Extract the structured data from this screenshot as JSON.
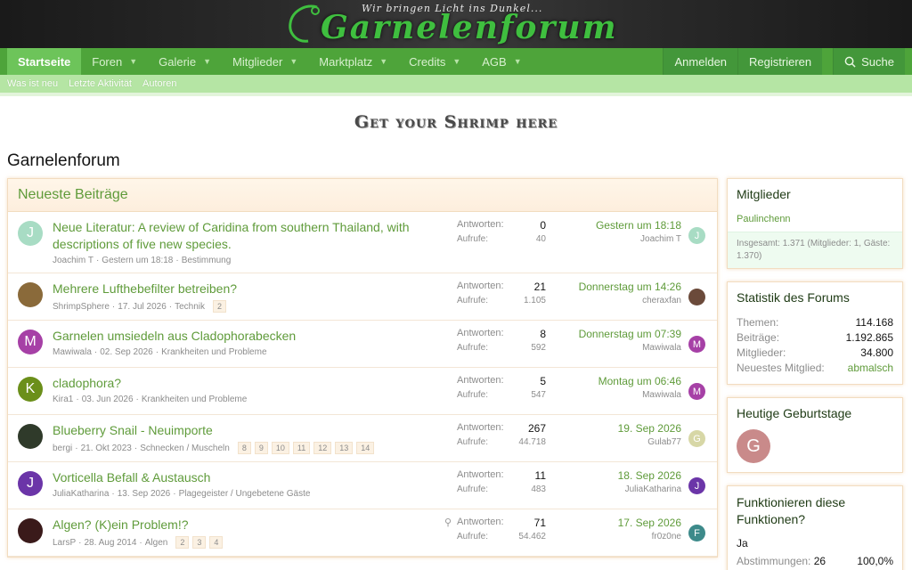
{
  "banner": {
    "tagline": "Wir bringen Licht ins Dunkel...",
    "brand": "Garnelenforum"
  },
  "nav": {
    "items": [
      {
        "label": "Startseite",
        "active": true,
        "caret": false
      },
      {
        "label": "Foren",
        "caret": true
      },
      {
        "label": "Galerie",
        "caret": true
      },
      {
        "label": "Mitglieder",
        "caret": true
      },
      {
        "label": "Marktplatz",
        "caret": true
      },
      {
        "label": "Credits",
        "caret": true
      },
      {
        "label": "AGB",
        "caret": true
      }
    ],
    "login": "Anmelden",
    "register": "Registrieren",
    "search": "Suche"
  },
  "subnav": [
    "Was ist neu",
    "Letzte Aktivität",
    "Autoren"
  ],
  "promo": "Get your Shrimp here",
  "page_title": "Garnelenforum",
  "latest": {
    "heading": "Neueste Beiträge",
    "answers_label": "Antworten:",
    "views_label": "Aufrufe:",
    "threads": [
      {
        "title": "Neue Literatur: A review of Caridina from southern Thailand, with descriptions of five new species.",
        "author": "Joachim T",
        "date": "Gestern um 18:18",
        "forum": "Bestimmung",
        "pages": [],
        "answers": "0",
        "views": "40",
        "last_date": "Gestern um 18:18",
        "last_user": "Joachim T",
        "avatar": "J",
        "avatar_color": "#a8dcc4",
        "last_avatar": "J",
        "last_avatar_color": "#a8dcc4",
        "pinned": false
      },
      {
        "title": "Mehrere Lufthebefilter betreiben?",
        "author": "ShrimpSphere",
        "date": "17. Jul 2026",
        "forum": "Technik",
        "pages": [
          "2"
        ],
        "answers": "21",
        "views": "1.105",
        "last_date": "Donnerstag um 14:26",
        "last_user": "cheraxfan",
        "avatar": "",
        "avatar_color": "#8a6a3a",
        "last_avatar": "",
        "last_avatar_color": "#6b4a3a",
        "pinned": false
      },
      {
        "title": "Garnelen umsiedeln aus Cladophorabecken",
        "author": "Mawiwala",
        "date": "02. Sep 2026",
        "forum": "Krankheiten und Probleme",
        "pages": [],
        "answers": "8",
        "views": "592",
        "last_date": "Donnerstag um 07:39",
        "last_user": "Mawiwala",
        "avatar": "M",
        "avatar_color": "#a640a6",
        "last_avatar": "M",
        "last_avatar_color": "#a640a6",
        "pinned": false
      },
      {
        "title": "cladophora?",
        "author": "Kira1",
        "date": "03. Jun 2026",
        "forum": "Krankheiten und Probleme",
        "pages": [],
        "answers": "5",
        "views": "547",
        "last_date": "Montag um 06:46",
        "last_user": "Mawiwala",
        "avatar": "K",
        "avatar_color": "#6b8f1a",
        "last_avatar": "M",
        "last_avatar_color": "#a640a6",
        "pinned": false
      },
      {
        "title": "Blueberry Snail - Neuimporte",
        "author": "bergi",
        "date": "21. Okt 2023",
        "forum": "Schnecken / Muscheln",
        "pages": [
          "8",
          "9",
          "10",
          "11",
          "12",
          "13",
          "14"
        ],
        "answers": "267",
        "views": "44.718",
        "last_date": "19. Sep 2026",
        "last_user": "Gulab77",
        "avatar": "",
        "avatar_color": "#2f3a2a",
        "last_avatar": "G",
        "last_avatar_color": "#d7d7a6",
        "pinned": false
      },
      {
        "title": "Vorticella Befall & Austausch",
        "author": "JuliaKatharina",
        "date": "13. Sep 2026",
        "forum": "Plagegeister / Ungebetene Gäste",
        "pages": [],
        "answers": "11",
        "views": "483",
        "last_date": "18. Sep 2026",
        "last_user": "JuliaKatharina",
        "avatar": "J",
        "avatar_color": "#6b35a8",
        "last_avatar": "J",
        "last_avatar_color": "#6b35a8",
        "pinned": false
      },
      {
        "title": "Algen? (K)ein Problem!?",
        "author": "LarsP",
        "date": "28. Aug 2014",
        "forum": "Algen",
        "pages": [
          "2",
          "3",
          "4"
        ],
        "answers": "71",
        "views": "54.462",
        "last_date": "17. Sep 2026",
        "last_user": "fr0z0ne",
        "avatar": "",
        "avatar_color": "#3a1a1a",
        "last_avatar": "F",
        "last_avatar_color": "#3d8a8a",
        "pinned": true
      }
    ]
  },
  "sidebar": {
    "members": {
      "heading": "Mitglieder",
      "online": "Paulinchenn",
      "footer": "Insgesamt: 1.371 (Mitglieder: 1, Gäste: 1.370)"
    },
    "stats": {
      "heading": "Statistik des Forums",
      "lines": [
        {
          "label": "Themen:",
          "value": "114.168"
        },
        {
          "label": "Beiträge:",
          "value": "1.192.865"
        },
        {
          "label": "Mitglieder:",
          "value": "34.800"
        },
        {
          "label": "Neuestes Mitglied:",
          "value": "abmalsch"
        }
      ]
    },
    "birthdays": {
      "heading": "Heutige Geburtstage",
      "avatar": "G"
    },
    "poll": {
      "heading": "Funktionieren diese Funktionen?",
      "answer": "Ja",
      "votes_label": "Abstimmungen:",
      "votes": "26",
      "percent": "100,0%",
      "fill": 1.0
    }
  }
}
